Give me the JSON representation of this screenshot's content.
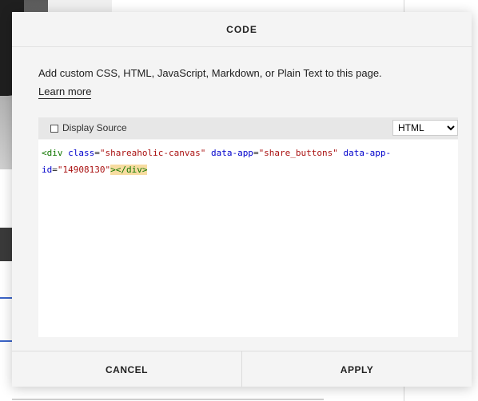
{
  "modal": {
    "title": "CODE",
    "description": "Add custom CSS, HTML, JavaScript, Markdown, or Plain Text to this page.",
    "learn_more": "Learn more"
  },
  "editor": {
    "display_source_label": "Display Source",
    "display_source_checked": false,
    "language_selected": "HTML",
    "code": {
      "t1": "<div",
      "a1": "class",
      "eq": "=",
      "s1": "\"shareaholic-canvas\"",
      "a2": "data-app",
      "s2": "\"share_buttons\"",
      "a3": "data-app-\nid",
      "s3": "\"14908130\"",
      "t2": ">",
      "t3": "</div>"
    }
  },
  "footer": {
    "cancel": "CANCEL",
    "apply": "APPLY"
  },
  "colors": {
    "tag": "#117700",
    "attr": "#0000cc",
    "string": "#aa1111",
    "bracket_match": "#f7dca0"
  }
}
